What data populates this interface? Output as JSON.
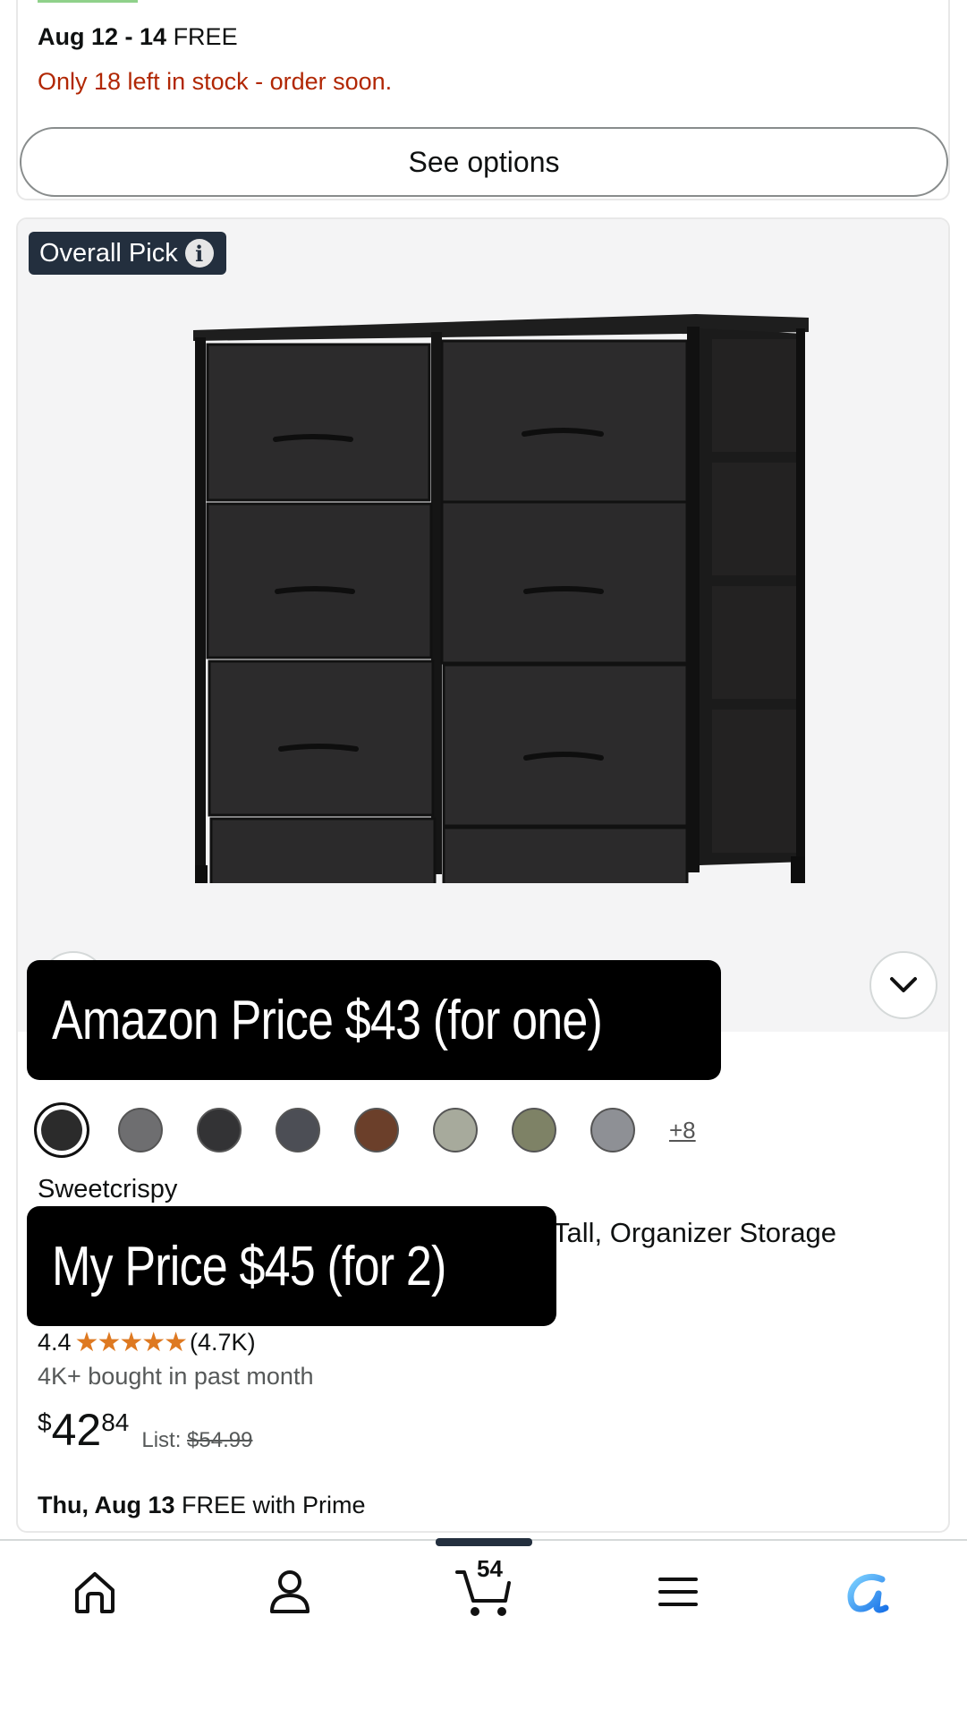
{
  "top_card": {
    "delivery_date": "Aug 12 - 14",
    "delivery_free": "FREE",
    "stock_message": "Only 18 left in stock - order soon.",
    "see_options_label": "See options"
  },
  "product": {
    "badge_label": "Overall Pick",
    "badge_info_icon": "info-icon",
    "more_colors": "+8",
    "brand": "Sweetcrispy",
    "title_visible": "Tall, Organizer Storage",
    "rating_value": "4.4",
    "stars": "★★★★★",
    "rating_count": "(4.7K)",
    "bought": "4K+ bought in past month",
    "price_currency": "$",
    "price_whole": "42",
    "price_fraction": "84",
    "list_label": "List:",
    "list_price": "$54.99",
    "ship_date": "Thu, Aug 13",
    "ship_text": "FREE with Prime"
  },
  "colors": {
    "swatches": [
      "#2b2b2b",
      "#6e6e70",
      "#333335",
      "#4c4e55",
      "#6b3f2a",
      "#a7aa9c",
      "#7e8266",
      "#8e9095"
    ],
    "overlay_bg": "#000000",
    "badge_bg": "#232f3e",
    "stock_red": "#b12704",
    "star_orange": "#de7921"
  },
  "overlays": {
    "amazon_price": "Amazon Price $43 (for one)",
    "my_price": "My Price $45 (for 2)"
  },
  "bottom_nav": {
    "items": [
      "home-icon",
      "account-icon",
      "cart-icon",
      "menu-icon",
      "rufus-icon"
    ],
    "cart_count": "54"
  }
}
